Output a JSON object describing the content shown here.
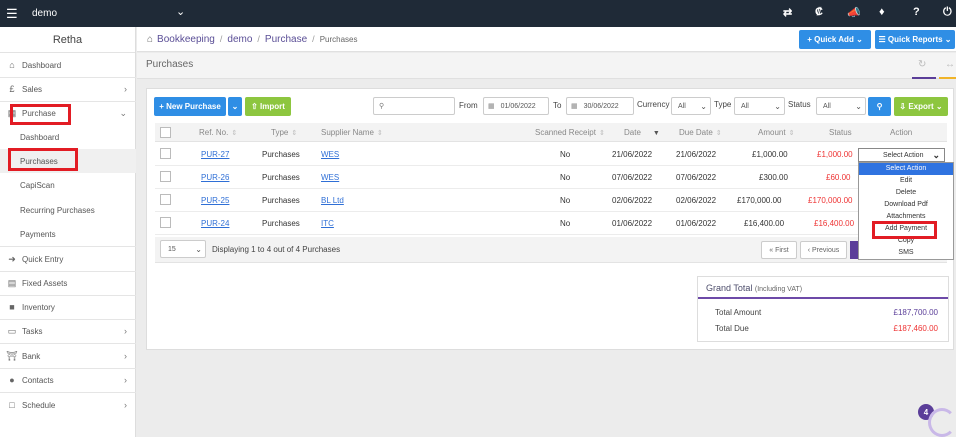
{
  "topbar": {
    "company": "demo",
    "icons": [
      "menu-icon",
      "chevron-down-icon",
      "switch-icon",
      "currency-icon",
      "megaphone-icon",
      "tag-icon",
      "help-icon",
      "power-icon"
    ]
  },
  "sidebar": {
    "title": "Retha",
    "items": [
      {
        "label": "Dashboard",
        "icon": "home-icon"
      },
      {
        "label": "Sales",
        "icon": "pound-icon"
      },
      {
        "label": "Purchase",
        "icon": "cart-icon"
      },
      {
        "label": "Quick Entry",
        "icon": "arrow-right-icon"
      },
      {
        "label": "Fixed Assets",
        "icon": "building-icon"
      },
      {
        "label": "Inventory",
        "icon": "truck-icon"
      },
      {
        "label": "Tasks",
        "icon": "folder-icon"
      },
      {
        "label": "Bank",
        "icon": "bank-icon"
      },
      {
        "label": "Contacts",
        "icon": "users-icon"
      },
      {
        "label": "Schedule",
        "icon": "calendar-icon"
      }
    ],
    "purchase_sub": [
      "Dashboard",
      "Purchases",
      "CapiScan",
      "Recurring Purchases",
      "Payments"
    ]
  },
  "breadcrumb": [
    "Bookkeeping",
    "demo",
    "Purchase",
    "Purchases"
  ],
  "header": {
    "quick_add": "Quick Add",
    "quick_reports": "Quick Reports"
  },
  "page": {
    "title": "Purchases"
  },
  "toolbar": {
    "new_purchase": "New Purchase",
    "import": "Import",
    "search_value": "",
    "from_label": "From",
    "from_date": "01/06/2022",
    "to_label": "To",
    "to_date": "30/06/2022",
    "currency_label": "Currency",
    "currency_value": "All",
    "type_label": "Type",
    "type_value": "All",
    "status_label": "Status",
    "status_value": "All",
    "export": "Export"
  },
  "table": {
    "columns": [
      "Ref. No.",
      "Type",
      "Supplier Name",
      "Scanned Receipt",
      "Date",
      "Due Date",
      "Amount",
      "Status",
      "Action"
    ],
    "rows": [
      {
        "ref": "PUR-27",
        "type": "Purchases",
        "supplier": "WES",
        "receipt": "No",
        "date": "21/06/2022",
        "due": "21/06/2022",
        "amount": "£1,000.00",
        "status": "£1,000.00"
      },
      {
        "ref": "PUR-26",
        "type": "Purchases",
        "supplier": "WES",
        "receipt": "No",
        "date": "07/06/2022",
        "due": "07/06/2022",
        "amount": "£300.00",
        "status": "£60.00"
      },
      {
        "ref": "PUR-25",
        "type": "Purchases",
        "supplier": "BL Ltd",
        "receipt": "No",
        "date": "02/06/2022",
        "due": "02/06/2022",
        "amount": "£170,000.00",
        "status": "£170,000.00"
      },
      {
        "ref": "PUR-24",
        "type": "Purchases",
        "supplier": "ITC",
        "receipt": "No",
        "date": "01/06/2022",
        "due": "01/06/2022",
        "amount": "£16,400.00",
        "status": "£16,400.00"
      }
    ]
  },
  "pagination": {
    "per_page": "15",
    "summary": "Displaying 1 to 4 out of 4 Purchases",
    "first": "« First",
    "previous": "‹ Previous"
  },
  "action_dropdown": {
    "selected": "Select Action",
    "options": [
      "Select Action",
      "Edit",
      "Delete",
      "Download Pdf",
      "Attachments",
      "Add Payment",
      "Copy",
      "SMS"
    ]
  },
  "grand_total": {
    "title": "Grand Total",
    "subtitle": "(Including VAT)",
    "total_amount_label": "Total Amount",
    "total_amount": "£187,700.00",
    "total_due_label": "Total Due",
    "total_due": "£187,460.00"
  },
  "notification_count": "4",
  "colors": {
    "topbar": "#1f2a37",
    "accent_blue": "#2f8ee5",
    "accent_green": "#8dc63f",
    "brand_purple": "#5b3e99",
    "highlight_red": "#e21c24"
  }
}
